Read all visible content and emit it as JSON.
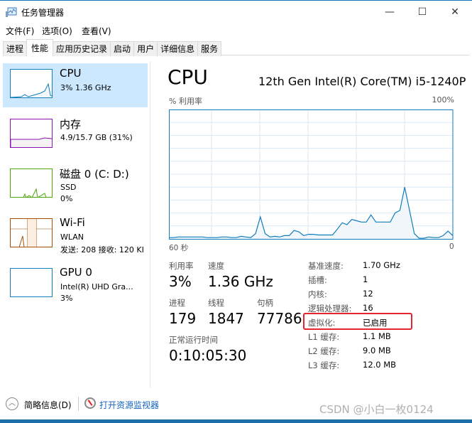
{
  "window": {
    "title": "任务管理器",
    "minimize": "—",
    "maximize": "☐",
    "close": "✕"
  },
  "menu": [
    "文件(F)",
    "选项(O)",
    "查看(V)"
  ],
  "tabs": [
    "进程",
    "性能",
    "应用历史记录",
    "启动",
    "用户",
    "详细信息",
    "服务"
  ],
  "active_tab": "性能",
  "sidebar": [
    {
      "title": "CPU",
      "lines": [
        "3% 1.36 GHz"
      ],
      "color": "#117dbb"
    },
    {
      "title": "内存",
      "lines": [
        "4.9/15.7 GB (31%)"
      ],
      "color": "#8b12ae"
    },
    {
      "title": "磁盘 0 (C: D:)",
      "lines": [
        "SSD",
        "0%"
      ],
      "color": "#4da60c"
    },
    {
      "title": "Wi-Fi",
      "lines": [
        "WLAN",
        "发送: 208 接收: 120 KI"
      ],
      "color": "#a74f01"
    },
    {
      "title": "GPU 0",
      "lines": [
        "Intel(R) UHD Gra...",
        "3%"
      ],
      "color": "#117dbb"
    }
  ],
  "main": {
    "title": "CPU",
    "model": "12th Gen Intel(R) Core(TM) i5-1240P",
    "chart_label": "% 利用率",
    "chart_max": "100%",
    "x_left": "60 秒",
    "x_right": "0",
    "stats": {
      "util_label": "利用率",
      "util": "3%",
      "speed_label": "速度",
      "speed": "1.36 GHz",
      "proc_label": "进程",
      "proc": "179",
      "thread_label": "线程",
      "thread": "1847",
      "handle_label": "句柄",
      "handle": "77786",
      "uptime_label": "正常运行时间",
      "uptime": "0:10:05:30"
    },
    "specs": [
      {
        "k": "基准速度:",
        "v": "1.70 GHz"
      },
      {
        "k": "插槽:",
        "v": "1"
      },
      {
        "k": "内核:",
        "v": "12"
      },
      {
        "k": "逻辑处理器:",
        "v": "16"
      },
      {
        "k": "虚拟化:",
        "v": "已启用"
      },
      {
        "k": "L1 缓存:",
        "v": "1.1 MB"
      },
      {
        "k": "L2 缓存:",
        "v": "9.0 MB"
      },
      {
        "k": "L3 缓存:",
        "v": "12.0 MB"
      }
    ],
    "highlight_color": "#e5262a"
  },
  "chart_data": {
    "type": "area",
    "ylim": [
      0,
      100
    ],
    "x_range_seconds": [
      60,
      0
    ],
    "grid": true,
    "color": "#117dbb",
    "values": [
      1,
      1,
      1.5,
      1.5,
      1.5,
      1.5,
      1.5,
      1.5,
      1,
      1,
      1,
      1.5,
      1.5,
      1,
      1,
      2,
      1.5,
      1,
      4,
      17,
      4,
      1.5,
      2,
      1.5,
      2.5,
      2.5,
      6.5,
      5.5,
      2.5,
      3.5,
      3.5,
      3,
      3,
      3,
      3,
      7.5,
      12.5,
      11,
      15,
      14,
      13,
      13,
      18.5,
      13,
      13,
      13,
      13,
      20,
      22,
      40,
      22,
      4,
      0.5,
      0.5,
      1.5,
      1,
      1,
      2.5,
      6,
      2.5
    ]
  },
  "footer": {
    "summary": "简略信息(D)",
    "resmon": "打开资源监视器"
  },
  "watermark": "CSDN @小白一枚0124"
}
